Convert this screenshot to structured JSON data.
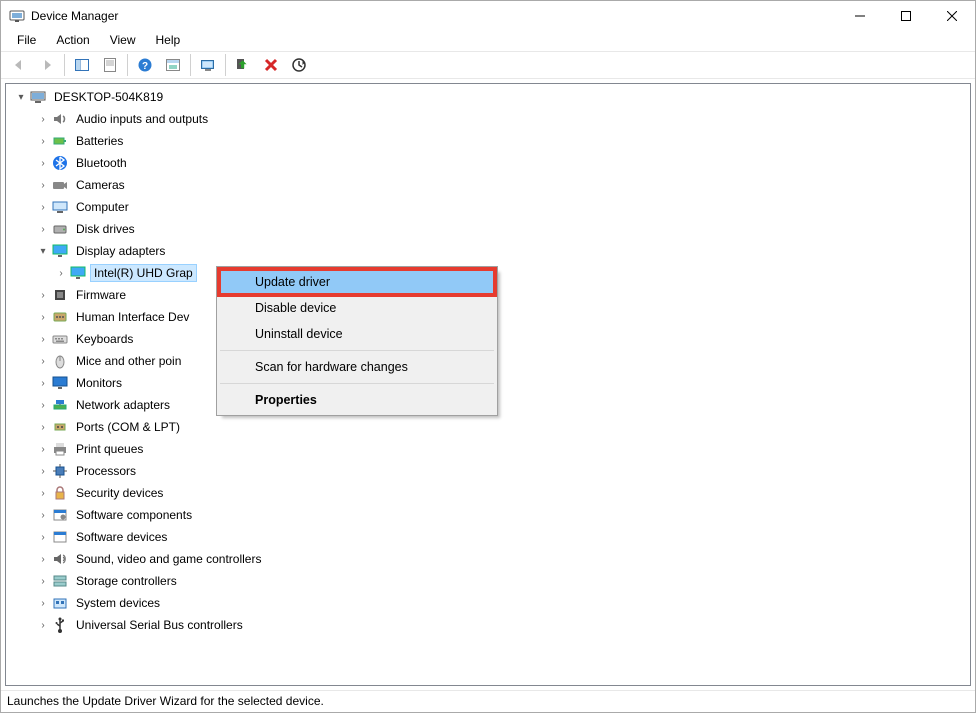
{
  "window": {
    "title": "Device Manager"
  },
  "menubar": {
    "items": [
      "File",
      "Action",
      "View",
      "Help"
    ]
  },
  "toolbar": {
    "buttons": [
      {
        "name": "back-icon",
        "disabled": true
      },
      {
        "name": "forward-icon",
        "disabled": true
      },
      {
        "sep": true
      },
      {
        "name": "show-hide-console-tree-icon"
      },
      {
        "name": "help-icon"
      },
      {
        "sep": true
      },
      {
        "name": "properties-icon"
      },
      {
        "name": "options-icon"
      },
      {
        "sep": true
      },
      {
        "name": "update-driver-icon"
      },
      {
        "sep": true
      },
      {
        "name": "enable-device-icon"
      },
      {
        "name": "uninstall-device-icon"
      },
      {
        "name": "scan-hardware-icon"
      }
    ]
  },
  "tree": {
    "root": {
      "label": "DESKTOP-504K819",
      "expanded": true
    },
    "nodes": [
      {
        "label": "Audio inputs and outputs",
        "icon": "speaker-icon"
      },
      {
        "label": "Batteries",
        "icon": "battery-icon"
      },
      {
        "label": "Bluetooth",
        "icon": "bluetooth-icon"
      },
      {
        "label": "Cameras",
        "icon": "camera-icon"
      },
      {
        "label": "Computer",
        "icon": "computer-icon"
      },
      {
        "label": "Disk drives",
        "icon": "disk-icon"
      },
      {
        "label": "Display adapters",
        "icon": "display-icon",
        "expanded": true,
        "children": [
          {
            "label": "Intel(R) UHD Graphics",
            "icon": "display-icon",
            "selected": true,
            "truncated": "Intel(R) UHD Grap"
          }
        ]
      },
      {
        "label": "Firmware",
        "icon": "firmware-icon"
      },
      {
        "label": "Human Interface Devices",
        "icon": "hid-icon",
        "truncated": "Human Interface Dev"
      },
      {
        "label": "Keyboards",
        "icon": "keyboard-icon"
      },
      {
        "label": "Mice and other pointing devices",
        "icon": "mouse-icon",
        "truncated": "Mice and other poin"
      },
      {
        "label": "Monitors",
        "icon": "monitor-icon"
      },
      {
        "label": "Network adapters",
        "icon": "network-icon"
      },
      {
        "label": "Ports (COM & LPT)",
        "icon": "ports-icon"
      },
      {
        "label": "Print queues",
        "icon": "printer-icon"
      },
      {
        "label": "Processors",
        "icon": "cpu-icon"
      },
      {
        "label": "Security devices",
        "icon": "security-icon"
      },
      {
        "label": "Software components",
        "icon": "software-comp-icon"
      },
      {
        "label": "Software devices",
        "icon": "software-dev-icon"
      },
      {
        "label": "Sound, video and game controllers",
        "icon": "sound-icon"
      },
      {
        "label": "Storage controllers",
        "icon": "storage-icon"
      },
      {
        "label": "System devices",
        "icon": "system-icon"
      },
      {
        "label": "Universal Serial Bus controllers",
        "icon": "usb-icon"
      }
    ]
  },
  "context_menu": {
    "items": [
      {
        "label": "Update driver",
        "highlight": true
      },
      {
        "label": "Disable device"
      },
      {
        "label": "Uninstall device"
      },
      {
        "sep": true
      },
      {
        "label": "Scan for hardware changes"
      },
      {
        "sep": true
      },
      {
        "label": "Properties",
        "bold": true
      }
    ]
  },
  "statusbar": {
    "text": "Launches the Update Driver Wizard for the selected device."
  }
}
